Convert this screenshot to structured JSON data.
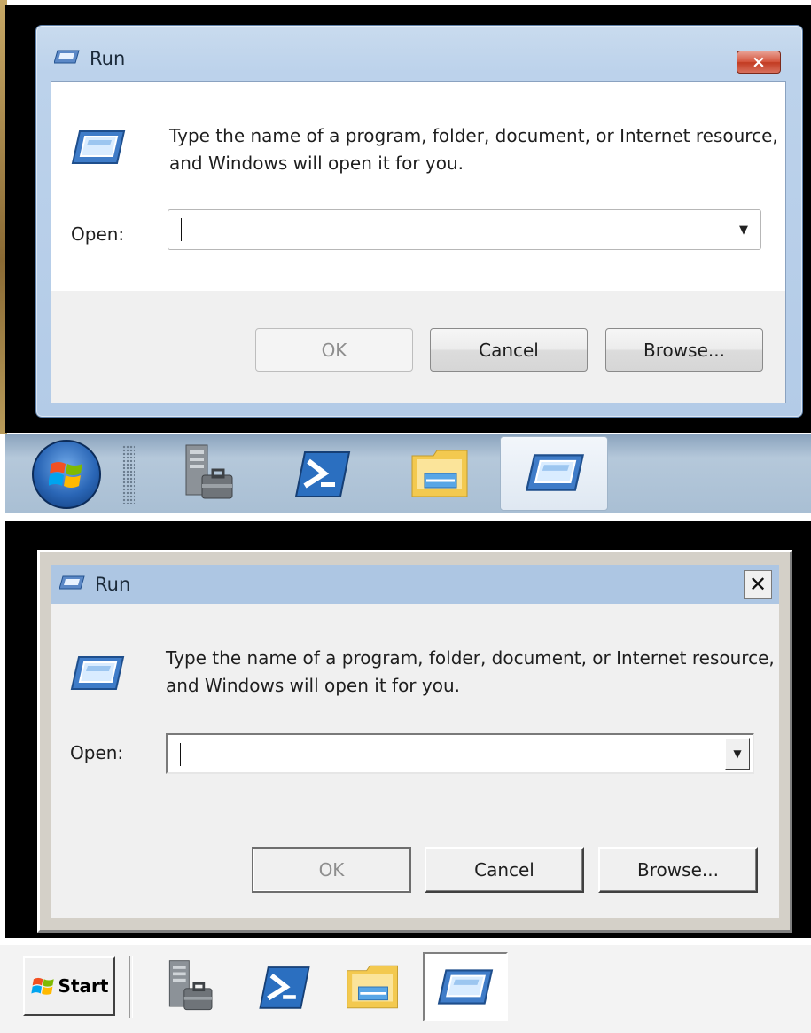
{
  "aero": {
    "dialog": {
      "title": "Run",
      "close_label": "×",
      "description": "Type the name of a program, folder, document, or Internet resource, and Windows will open it for you.",
      "open_label": "Open:",
      "open_value": "",
      "ok_label": "OK",
      "cancel_label": "Cancel",
      "browse_label": "Browse...",
      "ok_enabled": false
    },
    "taskbar": {
      "items": [
        "server-manager-icon",
        "powershell-icon",
        "file-explorer-icon",
        "run-icon"
      ],
      "active_item": "run-icon"
    }
  },
  "classic": {
    "dialog": {
      "title": "Run",
      "close_label": "✕",
      "description": "Type the name of a program, folder, document, or Internet resource, and Windows will open it for you.",
      "open_label": "Open:",
      "open_value": "",
      "ok_label": "OK",
      "cancel_label": "Cancel",
      "browse_label": "Browse...",
      "ok_enabled": false
    },
    "taskbar": {
      "start_label": "Start",
      "items": [
        "server-manager-icon",
        "powershell-icon",
        "file-explorer-icon",
        "run-icon"
      ],
      "active_item": "run-icon"
    }
  },
  "colors": {
    "aero_frame": "#b3cbe7",
    "aero_close": "#c23b22",
    "classic_title": "#adc6e3",
    "classic_face": "#d4d0c8",
    "taskbar_aero": "#a9bfd4"
  }
}
